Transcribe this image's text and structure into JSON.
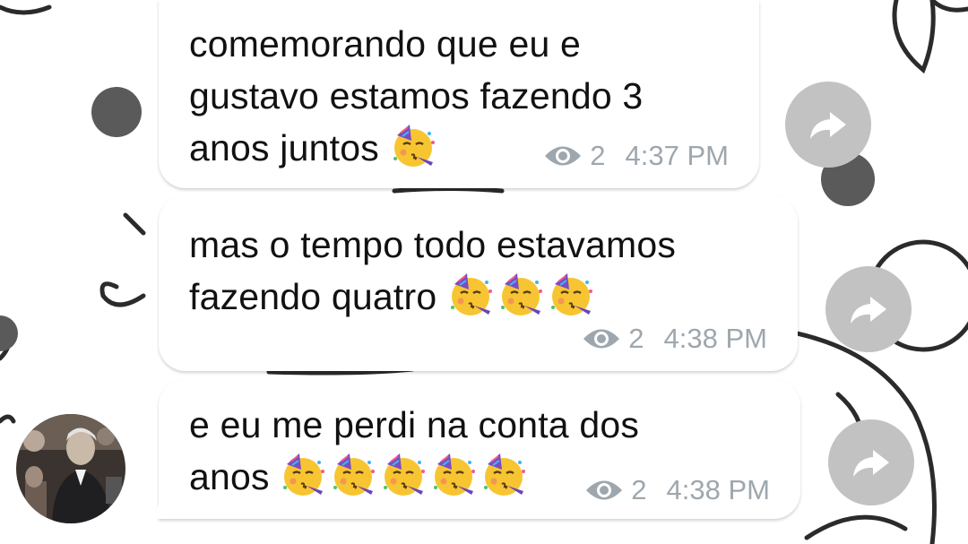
{
  "messages": [
    {
      "lines": [
        "comemorando que eu e",
        "gustavo estamos fazendo 3",
        "anos juntos"
      ],
      "emoji_count": 1,
      "views": "2",
      "time": "4:37 PM"
    },
    {
      "lines": [
        "mas o tempo todo estavamos",
        "fazendo quatro"
      ],
      "emoji_count": 3,
      "views": "2",
      "time": "4:38 PM"
    },
    {
      "lines": [
        "e eu me perdi na conta dos",
        "anos"
      ],
      "emoji_count": 5,
      "views": "2",
      "time": "4:38 PM"
    }
  ],
  "icons": {
    "emoji": "partying-face-icon",
    "views": "eye-icon",
    "share": "share-arrow-icon"
  },
  "colors": {
    "background": "#ffffff",
    "bubble": "#ffffff",
    "text": "#111111",
    "meta": "#9ea7ae",
    "share_button": "#c2c2c2",
    "doodle": "#2b2b2b"
  }
}
